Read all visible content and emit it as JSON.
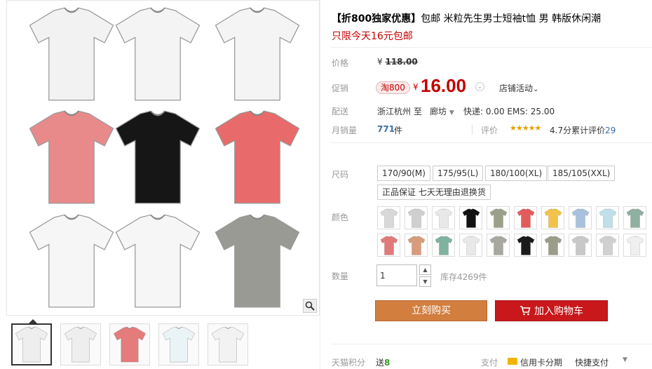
{
  "product": {
    "title_tag": "【折800独家优惠】",
    "title": "包邮 米粒先生男士短袖t恤 男 韩版休闲潮",
    "subtitle": "只限今天16元包邮"
  },
  "price": {
    "label": "价格",
    "currency": "¥",
    "original": "118.00",
    "promo_label": "促销",
    "promo_tag": "淘800",
    "current": "16.00",
    "store_activity": "店铺活动"
  },
  "shipping": {
    "label": "配送",
    "from": "浙江杭州",
    "to_word": "至",
    "destination": "廊坊",
    "cost": "快递: 0.00 EMS: 25.00"
  },
  "sales": {
    "label": "月销量",
    "count": "771",
    "unit": "件",
    "review_label": "评价",
    "stars": "★★★★★",
    "score": "4.7分",
    "review_text": "累计评价",
    "review_count": "29"
  },
  "sizes": {
    "label": "尺码",
    "options": [
      "170/90(M)",
      "175/95(L)",
      "180/100(XL)",
      "185/105(XXL)"
    ],
    "guarantee": "正品保证 七天无理由退换货"
  },
  "colors": {
    "label": "颜色",
    "swatches": [
      "#d8d8d8",
      "#cfcfcf",
      "#e8e8e8",
      "#111111",
      "#9aa08a",
      "#e25b5b",
      "#f2c24a",
      "#a9c1dd",
      "#bfe0e8",
      "#8fb0a0",
      "#e07a7a",
      "#d89c7a",
      "#7fb39f",
      "#e8e8e8",
      "#a8a8a0",
      "#1a1a1a",
      "#9c9c8a",
      "#c8c8c8",
      "#d0d0d0",
      "#efefef"
    ]
  },
  "quantity": {
    "label": "数量",
    "value": "1",
    "stock": "库存4269件"
  },
  "actions": {
    "buy_now": "立刻购买",
    "add_cart": "加入购物车"
  },
  "footer": {
    "points_label": "天猫积分",
    "points_prefix": "送",
    "points_value": "8",
    "pay_label": "支付",
    "installment": "信用卡分期",
    "quick_pay": "快捷支付"
  },
  "gallery": {
    "shirt_colors": [
      "#f2f2f2",
      "#f4f4f4",
      "#f4f4f4",
      "#e88a8a",
      "#161616",
      "#e86a6a",
      "#f6f6f6",
      "#f6f6f6",
      "#9a9a94"
    ],
    "thumb_colors": [
      "#eeeeee",
      "#eeeeee",
      "#e57b7b",
      "#eaf4f6",
      "#f2f2f2"
    ]
  }
}
